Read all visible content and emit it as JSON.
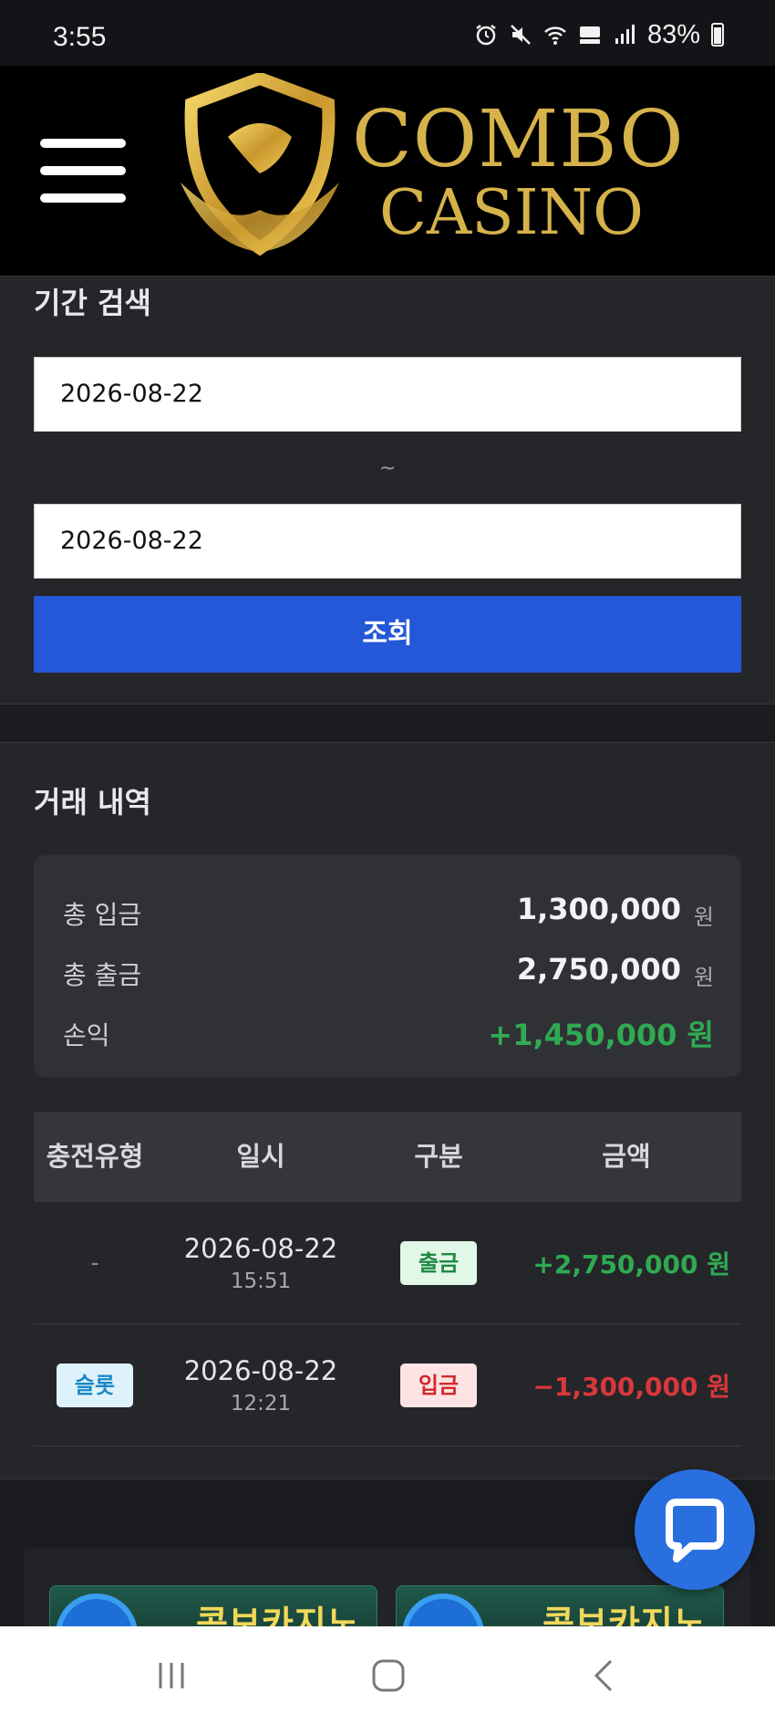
{
  "status_bar": {
    "time": "3:55",
    "battery": "83%",
    "icons": [
      "alarm-icon",
      "mute-icon",
      "wifi-icon",
      "hd-voice-icon",
      "signal-icon",
      "battery-icon"
    ]
  },
  "header": {
    "menu_icon": "hamburger-menu-icon",
    "logo_line1": "COMBO",
    "logo_line2": "CASINO"
  },
  "search": {
    "title": "기간 검색",
    "start_date": "2026-08-22",
    "separator": "~",
    "end_date": "2026-08-22",
    "button_label": "조회"
  },
  "history": {
    "title": "거래 내역",
    "summary": {
      "deposit_label": "총 입금",
      "deposit_value": "1,300,000",
      "withdraw_label": "총 출금",
      "withdraw_value": "2,750,000",
      "unit": "원",
      "profit_label": "손익",
      "profit_value": "+1,450,000 원"
    },
    "table": {
      "headers": [
        "충전유형",
        "일시",
        "구분",
        "금액"
      ],
      "rows": [
        {
          "type": "-",
          "date": "2026-08-22",
          "time": "15:51",
          "kind": "출금",
          "amount": "+2,750,000 원"
        },
        {
          "type": "슬롯",
          "date": "2026-08-22",
          "time": "12:21",
          "kind": "입금",
          "amount": "−1,300,000 원"
        }
      ]
    }
  },
  "banners": [
    {
      "text": "콤보카지노"
    },
    {
      "text": "콤보카지노"
    }
  ],
  "colors": {
    "accent_blue": "#2458d8",
    "profit_green": "#2faa52",
    "loss_red": "#d8383b",
    "logo_gold": "#d6b24a"
  },
  "nav": {
    "icons": [
      "recent-apps-icon",
      "home-icon",
      "back-icon"
    ]
  }
}
